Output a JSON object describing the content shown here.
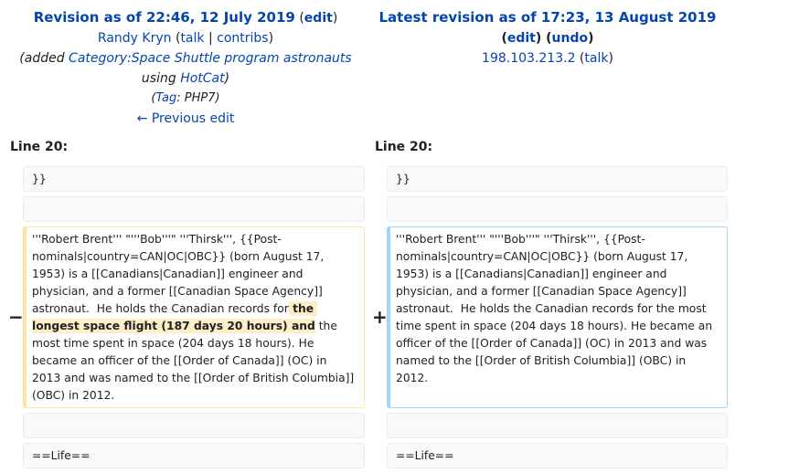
{
  "left_header": {
    "title": "Revision as of 22:46, 12 July 2019",
    "edit_label": "edit",
    "user": "Randy Kryn",
    "talk": "talk",
    "contribs": "contribs",
    "summary_prefix": "(added ",
    "category_link": "Category:Space Shuttle program astronauts",
    "summary_using": "using ",
    "hotcat": "HotCat",
    "summary_suffix": ")",
    "tag_prefix": "(",
    "tag_link": "Tag",
    "tag_rest": ": PHP7)",
    "prev_edit": "← Previous edit"
  },
  "right_header": {
    "title": "Latest revision as of 17:23, 13 August 2019",
    "edit_label": "edit",
    "undo_label": "undo",
    "ip": "198.103.213.2",
    "talk": "talk"
  },
  "line_numbers": {
    "left": "Line 20:",
    "right": "Line 20:"
  },
  "diff": {
    "context1": "}}",
    "context2": "",
    "deleted": {
      "before": "'''Robert Brent''' \"'''Bob'''\" '''Thirsk''', {{Post-nominals|country=CAN|OC|OBC}} (born August 17, 1953) is a [[Canadians|Canadian]] engineer and physician, and a former [[Canadian Space Agency]] astronaut.  He holds the Canadian records for",
      "highlight": " the longest space flight (187 days 20 hours) and",
      "after": " the most time spent in space (204 days 18 hours). He became an officer of the [[Order of Canada]] (OC) in 2013 and was named to the [[Order of British Columbia]] (OBC) in 2012."
    },
    "inserted": "'''Robert Brent''' \"'''Bob'''\" '''Thirsk''', {{Post-nominals|country=CAN|OC|OBC}} (born August 17, 1953) is a [[Canadians|Canadian]] engineer and physician, and a former [[Canadian Space Agency]] astronaut.  He holds the Canadian records for the most time spent in space (204 days 18 hours). He became an officer of the [[Order of Canada]] (OC) in 2013 and was named to the [[Order of British Columbia]] (OBC) in 2012.",
    "context3": "",
    "context4": "==Life==",
    "minus": "−",
    "plus": "+"
  }
}
